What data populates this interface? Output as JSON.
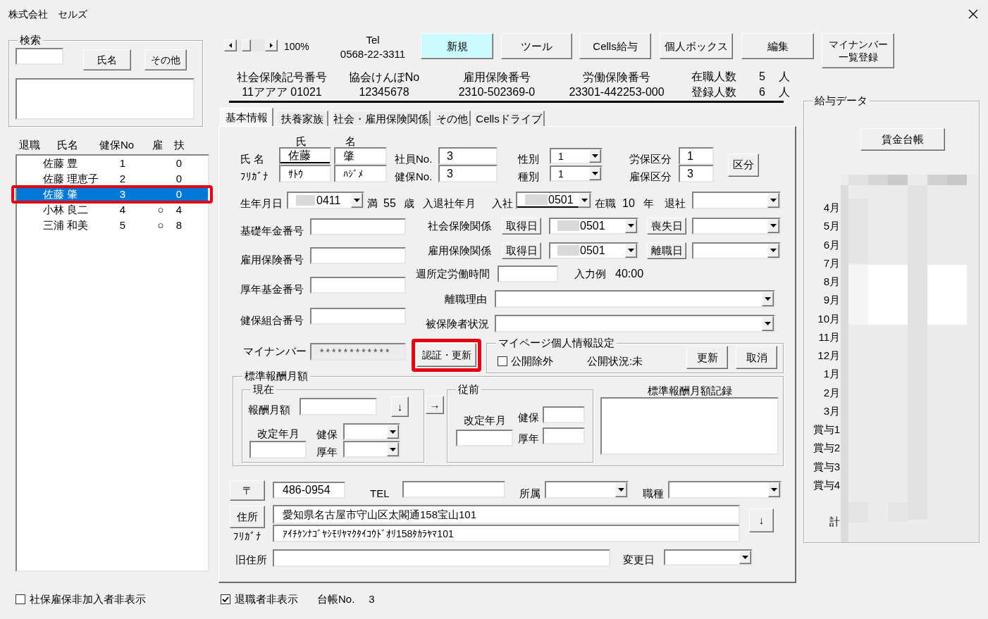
{
  "window": {
    "title": "株式会社　セルズ"
  },
  "search": {
    "title": "検索",
    "buttons": [
      {
        "label": "氏名"
      },
      {
        "label": "その他"
      }
    ]
  },
  "employee_list": {
    "columns": [
      "退職",
      "氏名",
      "健保No",
      "雇",
      "扶"
    ],
    "rows": [
      {
        "name": "佐藤 豊",
        "health_no": "1",
        "dependents": "0",
        "selected": false,
        "highlighted": false
      },
      {
        "name": "佐藤 理恵子",
        "health_no": "2",
        "dependents": "0",
        "selected": false,
        "highlighted": false
      },
      {
        "name": "佐藤 肇",
        "health_no": "3",
        "dependents": "0",
        "selected": true,
        "highlighted": true
      },
      {
        "name": "小林 良二",
        "health_no": "4",
        "employment": "○",
        "dependents": "4",
        "selected": false,
        "highlighted": false
      },
      {
        "name": "三浦 和美",
        "health_no": "5",
        "employment": "○",
        "dependents": "8",
        "selected": false,
        "highlighted": false
      }
    ]
  },
  "left_filter": {
    "label": "社保雇保非加入者非表示",
    "checked": false
  },
  "zoom": {
    "value": "100%"
  },
  "tel": {
    "label": "Tel",
    "value": "0568-22-3311"
  },
  "toolbar": [
    {
      "label": "新規",
      "active": true
    },
    {
      "label": "ツール",
      "active": false
    },
    {
      "label": "Cells給与",
      "active": false
    },
    {
      "label": "個人ボックス",
      "active": false
    },
    {
      "label": "編集",
      "active": false
    },
    {
      "label": "マイナンバー一覧登録",
      "active": false
    }
  ],
  "office": {
    "fields": [
      {
        "label": "社会保険記号番号",
        "value": "11アアア 01021"
      },
      {
        "label": "協会けんぽNo",
        "value": "12345678"
      },
      {
        "label": "雇用保険番号",
        "value": "2310-502369-0"
      },
      {
        "label": "労働保険番号",
        "value": "23301-442253-000"
      }
    ],
    "counts": [
      {
        "label": "在職人数",
        "value": "5",
        "unit": "人"
      },
      {
        "label": "登録人数",
        "value": "6",
        "unit": "人"
      }
    ]
  },
  "tabs": [
    {
      "label": "基本情報",
      "selected": true
    },
    {
      "label": "扶養家族",
      "selected": false
    },
    {
      "label": "社会・雇用保険関係",
      "selected": false
    },
    {
      "label": "その他",
      "selected": false
    },
    {
      "label": "Cellsドライブ",
      "selected": false
    }
  ],
  "basic": {
    "name_headers": [
      "氏",
      "名"
    ],
    "name_label": "氏 名",
    "name_values": [
      {
        "value": "佐藤",
        "underlined": true
      },
      {
        "value": "肇",
        "underlined": false
      }
    ],
    "kana_label": "ﾌﾘｶﾞﾅ",
    "kana_values": [
      "ｻﾄｳ",
      "ﾊｼﾞﾒ"
    ],
    "numbers": [
      {
        "label": "社員No.",
        "value": "3"
      },
      {
        "label": "健保No.",
        "value": "3"
      }
    ],
    "types": [
      {
        "label": "性別",
        "value": "1"
      },
      {
        "label": "種別",
        "value": "1"
      }
    ],
    "classes": [
      {
        "label": "労保区分",
        "value": "1"
      },
      {
        "label": "雇保区分",
        "value": "3"
      }
    ],
    "class_button": "区分",
    "birth": {
      "label": "生年月日",
      "value": "0411",
      "redacted": true
    },
    "age": {
      "prefix": "満",
      "value": "55",
      "unit": "歳"
    },
    "hire_leave_label": "入退社年月",
    "hire": {
      "label": "入社",
      "value": "0501",
      "redacted": true,
      "underlined": true
    },
    "tenure": {
      "prefix": "在職",
      "value": "10",
      "unit": "年"
    },
    "leave": {
      "label": "退社"
    },
    "codes": [
      {
        "label": "基礎年金番号"
      },
      {
        "label": "雇用保険番号"
      },
      {
        "label": "厚年基金番号"
      },
      {
        "label": "健保組合番号"
      }
    ],
    "insurance": [
      {
        "label": "社会保険関係",
        "acquired_button": "取得日",
        "acquired": "0501",
        "redacted": true,
        "lost_button": "喪失日"
      },
      {
        "label": "雇用保険関係",
        "acquired_button": "取得日",
        "acquired": "0501",
        "redacted": true,
        "lost_button": "離職日"
      }
    ],
    "weekly_hours": {
      "label": "週所定労働時間",
      "example_label": "入力例",
      "example_value": "40:00"
    },
    "separation_reason": {
      "label": "離職理由"
    },
    "insured_status": {
      "label": "被保険者状況"
    },
    "my_number": {
      "label": "マイナンバー",
      "value": "************"
    },
    "auth_button": {
      "label": "認証・更新",
      "highlighted": true
    },
    "mypage": {
      "title": "マイページ個人情報設定",
      "exclude": {
        "label": "公開除外",
        "checked": false
      },
      "status": "公開状況:未",
      "buttons": [
        "更新",
        "取消"
      ]
    }
  },
  "standard_pay": {
    "title": "標準報酬月額",
    "current": {
      "title": "現在",
      "amount_label": "報酬月額",
      "copy_button": "↓",
      "revision_label": "改定年月",
      "health_label": "健保",
      "pension_label": "厚年"
    },
    "move_button": "→",
    "previous": {
      "title": "従前",
      "revision_label": "改定年月",
      "health_label": "健保",
      "pension_label": "厚年"
    },
    "history_label": "標準報酬月額記録"
  },
  "address": {
    "postal_button": "〒",
    "postal": "486-0954",
    "tel_label": "TEL",
    "dept_label": "所属",
    "job_label": "職種",
    "address_button": "住所",
    "address": "愛知県名古屋市守山区太閣通158宝山101",
    "kana_label": "ﾌﾘｶﾞﾅ",
    "kana": "ｱｲﾁｹﾝﾅｺﾞﾔｼﾓﾘﾔﾏｸﾀｲｺｳﾄﾞｵﾘ158ﾀｶﾗﾔﾏ101",
    "copy_button": "↓",
    "old_label": "旧住所",
    "changed_label": "変更日"
  },
  "payroll": {
    "title": "給与データ",
    "ledger_button": "賃金台帳",
    "rows": [
      "4月",
      "5月",
      "6月",
      "7月",
      "8月",
      "9月",
      "10月",
      "11月",
      "12月",
      "1月",
      "2月",
      "3月",
      "賞与1",
      "賞与2",
      "賞与3",
      "賞与4"
    ],
    "total_label": "計"
  },
  "footer": {
    "hide_retired": {
      "label": "退職者非表示",
      "checked": true
    },
    "ledger_label": "台帳No.",
    "ledger_no": "3"
  }
}
